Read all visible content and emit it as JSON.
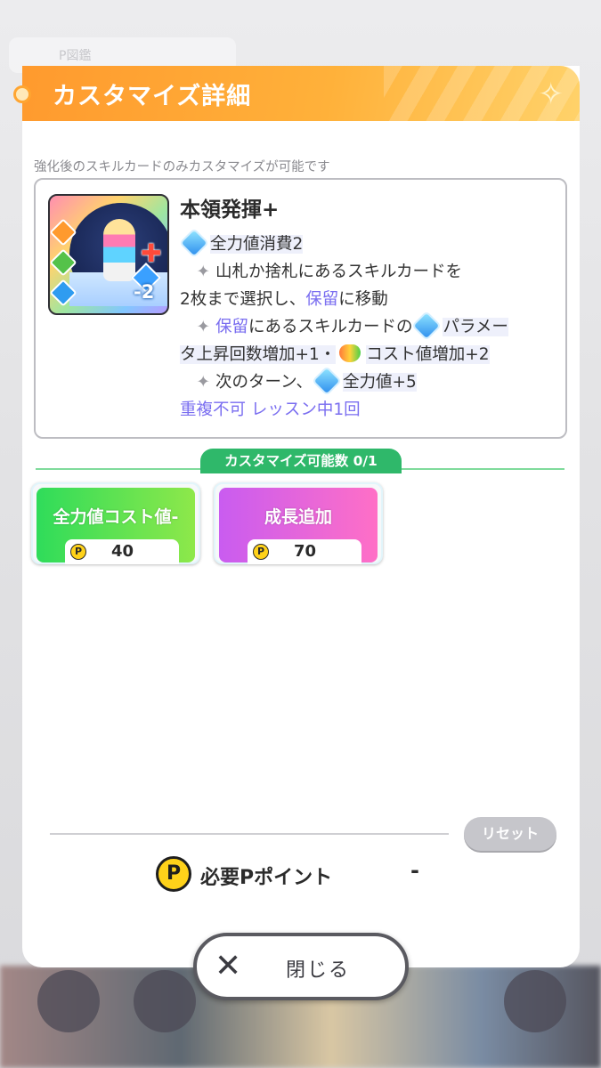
{
  "background": {
    "card_label": "P図鑑"
  },
  "dialog": {
    "title": "カスタマイズ詳細",
    "hint": "強化後のスキルカードのみカスタマイズが可能です"
  },
  "card": {
    "name": "本領発揮+",
    "cost": "-2",
    "line1": "全力値消費2",
    "line2": "山札か捨札にあるスキルカードを",
    "line3a": "2枚まで選択し、",
    "line3_kw": "保留",
    "line3b": "に移動",
    "line4_kw": "保留",
    "line4a": "にあるスキルカードの",
    "line4b": "パラメー",
    "line5a": "タ上昇回数増加+1・",
    "line5b": "コスト値増加+2",
    "line6a": "次のターン、",
    "line6b": "全力値+5",
    "footer": "重複不可 レッスン中1回"
  },
  "customize": {
    "count_label": "カスタマイズ可能数 0/1",
    "options": [
      {
        "label": "全力値コスト値-",
        "cost": "40",
        "color": "#3fe052"
      },
      {
        "label": "成長追加",
        "cost": "70",
        "color": "#d65df0"
      }
    ]
  },
  "footer": {
    "reset_label": "リセット",
    "required_label": "必要Pポイント",
    "required_value": "-",
    "coin_symbol": "P",
    "close_label": "閉じる"
  }
}
